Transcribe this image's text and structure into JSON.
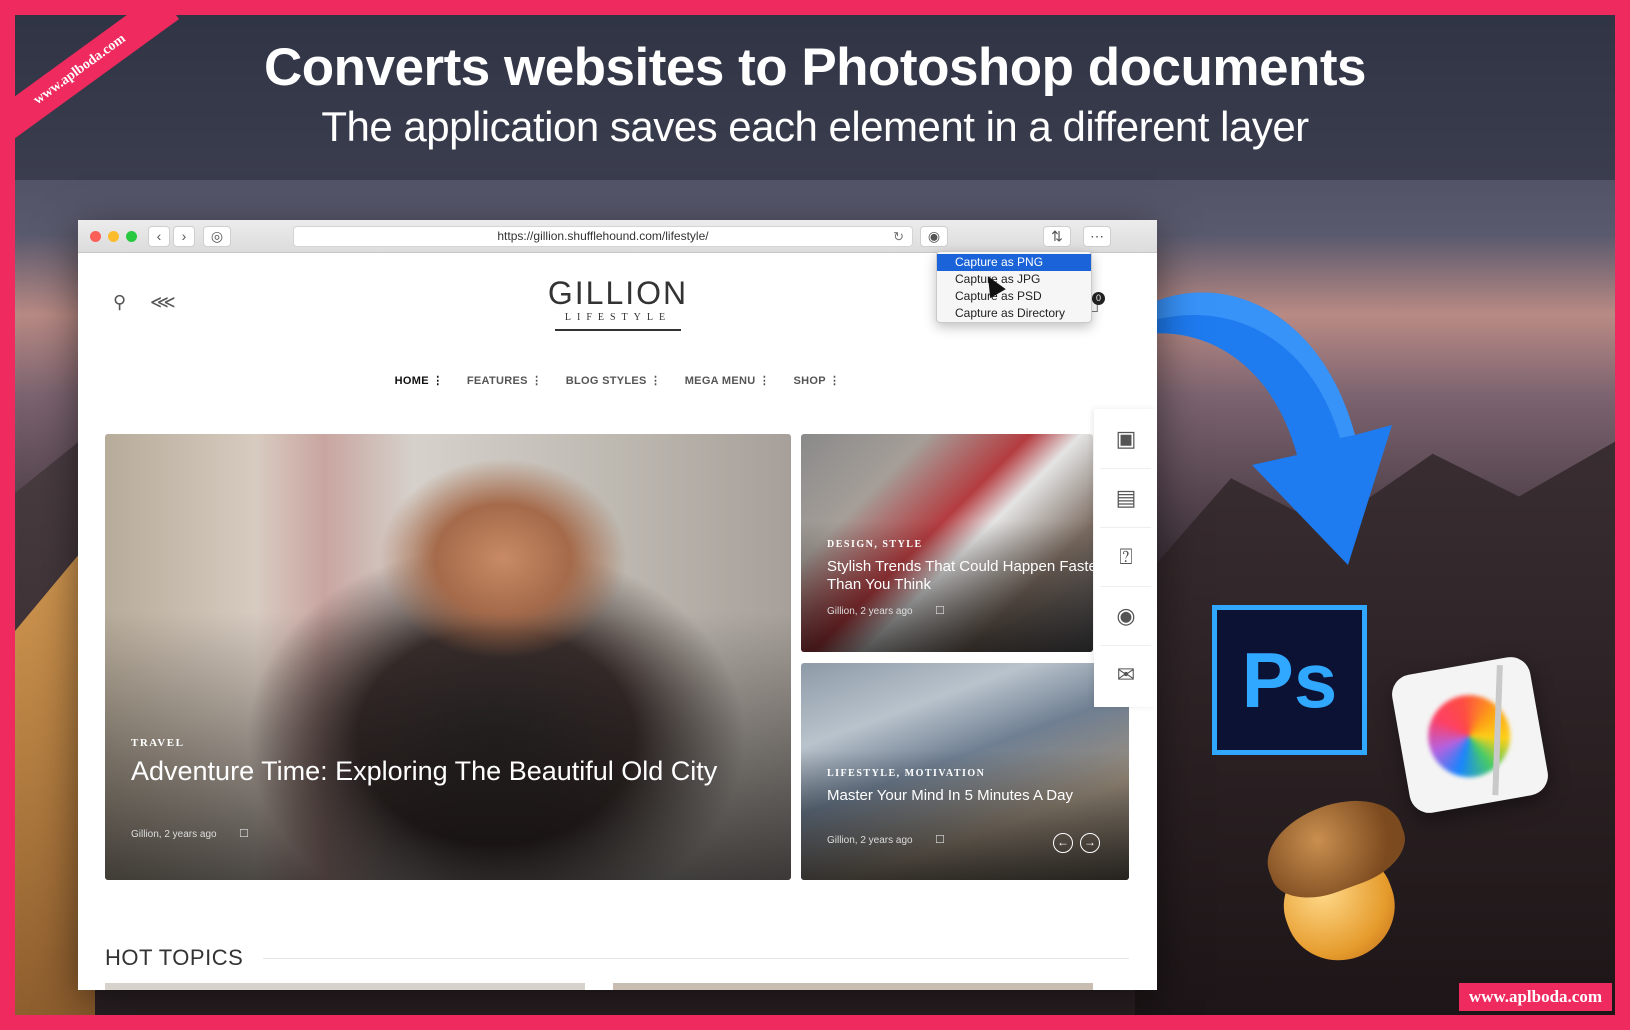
{
  "banner": {
    "headline": "Converts websites to Photoshop documents",
    "subhead": "The application saves each element in a different layer",
    "ribbon": "www.aplboda.com",
    "watermark": "www.aplboda.com"
  },
  "browser": {
    "url": "https://gillion.shufflehound.com/lifestyle/",
    "capture_menu": [
      "Capture as PNG",
      "Capture as JPG",
      "Capture as PSD",
      "Capture as Directory"
    ],
    "selected_index": 0
  },
  "site": {
    "logo": "GILLION",
    "logo_sub": "LIFESTYLE",
    "bookmark_count": "0",
    "nav": [
      "HOME",
      "FEATURES",
      "BLOG STYLES",
      "MEGA MENU",
      "SHOP"
    ],
    "posts": [
      {
        "category": "TRAVEL",
        "title": "Adventure Time: Exploring The Beautiful Old City",
        "meta": "Gillion, 2 years ago"
      },
      {
        "category": "DESIGN, STYLE",
        "title": "Stylish Trends That Could Happen Faster Than You Think",
        "meta": "Gillion, 2 years ago"
      },
      {
        "category": "LIFESTYLE, MOTIVATION",
        "title": "Master Your Mind In 5 Minutes A Day",
        "meta": "Gillion, 2 years ago"
      }
    ],
    "section_title": "HOT TOPICS"
  },
  "apps": {
    "photoshop_label": "Ps"
  },
  "colors": {
    "border": "#ee2a5e",
    "menu_selected": "#1a63d8",
    "ps_blue": "#31a8ff",
    "arrow_blue": "#1e7bf0"
  }
}
